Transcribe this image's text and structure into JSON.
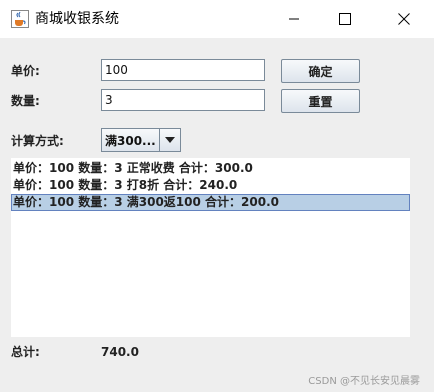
{
  "window": {
    "title": "商城收银系统"
  },
  "form": {
    "price_label": "单价:",
    "price_value": "100",
    "quantity_label": "数量:",
    "quantity_value": "3",
    "confirm_label": "确定",
    "reset_label": "重置",
    "method_label": "计算方式:",
    "method_selected": "满300..."
  },
  "results": [
    "单价：100 数量：3 正常收费 合计：300.0",
    "单价：100 数量：3 打8折 合计：240.0",
    "单价：100 数量：3 满300返100 合计：200.0"
  ],
  "selected_row": 2,
  "total": {
    "label": "总计:",
    "value": "740.0"
  },
  "watermark": "CSDN @不见长安见晨雾",
  "colors": {
    "selection": "#b8cfe5",
    "selection_border": "#6382bf"
  },
  "icons": [
    "java-cup-icon",
    "minimize-icon",
    "maximize-icon",
    "close-icon",
    "chevron-down-icon"
  ]
}
